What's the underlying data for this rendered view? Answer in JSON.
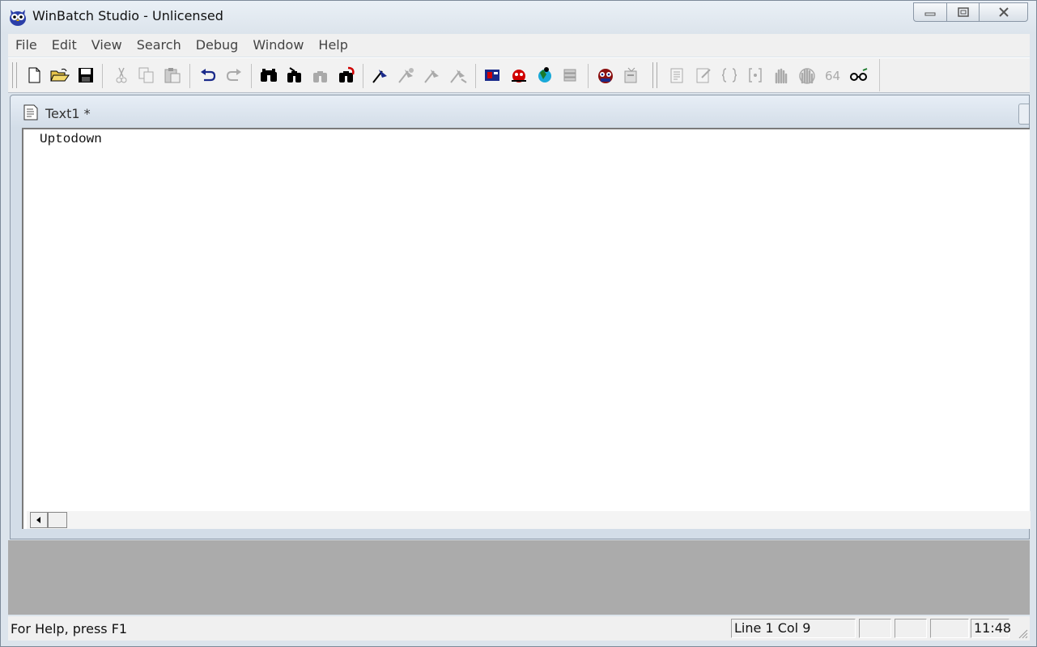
{
  "window": {
    "title": "WinBatch Studio - Unlicensed"
  },
  "menu": [
    "File",
    "Edit",
    "View",
    "Search",
    "Debug",
    "Window",
    "Help"
  ],
  "toolbar_icons": [
    "new-file-icon",
    "open-folder-icon",
    "save-icon",
    "cut-icon",
    "copy-icon",
    "paste-icon",
    "undo-icon",
    "redo-icon",
    "find-icon",
    "find-next-icon",
    "find-prev-icon",
    "replace-icon",
    "breakpoint-icon",
    "step-icon",
    "step-over-icon",
    "step-out-icon",
    "dialog-editor-icon",
    "bug-icon",
    "world-icon",
    "stack-icon",
    "owl-icon",
    "properties-icon",
    "doc-list-icon",
    "edit-doc-icon",
    "brace-icon",
    "bracket-icon",
    "hand-icon",
    "hand-stop-icon",
    "64-label",
    "glasses-icon"
  ],
  "document": {
    "title": "Text1 *",
    "content": "Uptodown"
  },
  "status": {
    "message": "For Help, press F1",
    "position": "Line 1 Col 9",
    "time": "11:48"
  },
  "colors": {
    "workspace": "#ababab",
    "editor_bg": "#ffffff",
    "chrome": "#dce4ec"
  }
}
